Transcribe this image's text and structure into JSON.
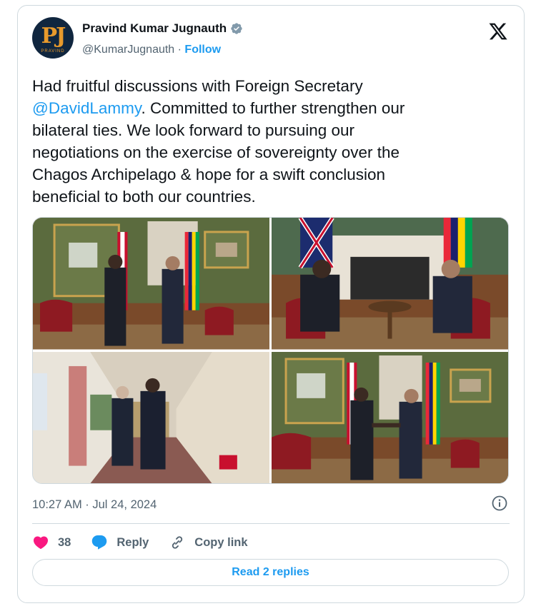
{
  "author": {
    "name": "Pravind Kumar Jugnauth",
    "handle": "@KumarJugnauth",
    "separator": " · ",
    "follow_label": "Follow",
    "avatar_letters": "PJ",
    "avatar_subtext": "PRAVIND"
  },
  "tweet": {
    "text_before": "Had fruitful discussions with Foreign Secretary\n",
    "mention": "@DavidLammy",
    "text_after": ". Committed to further strengthen our\nbilateral ties. We look forward to pursuing our\nnegotiations on the exercise of sovereignty over the\nChagos Archipelago & hope for a swift conclusion\nbeneficial to both our countries."
  },
  "photos": [
    {
      "icon": "photo-standing-flags"
    },
    {
      "icon": "photo-seated-meeting"
    },
    {
      "icon": "photo-corridor-walk"
    },
    {
      "icon": "photo-handshake"
    }
  ],
  "timestamp": "10:27 AM · Jul 24, 2024",
  "actions": {
    "like_count": "38",
    "reply_label": "Reply",
    "copy_label": "Copy link"
  },
  "read_replies_label": "Read 2 replies",
  "colors": {
    "accent": "#1d9bf0",
    "like": "#f91880",
    "text": "#0f1419",
    "muted": "#536471",
    "border": "#cfd9de"
  }
}
